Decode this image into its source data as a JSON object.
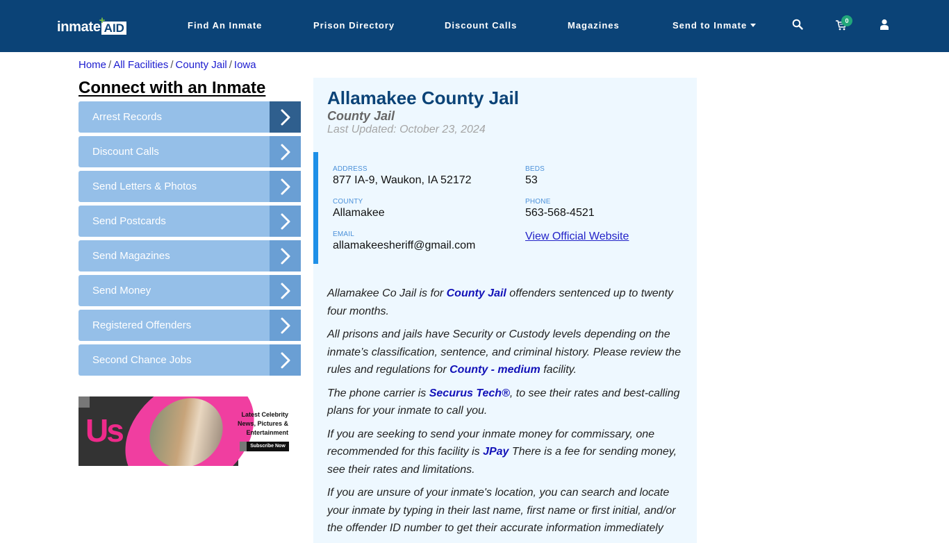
{
  "header": {
    "logo": {
      "part1": "inmate",
      "part2": "AID",
      "plus": "+"
    },
    "nav": [
      {
        "label": "Find An Inmate"
      },
      {
        "label": "Prison Directory"
      },
      {
        "label": "Discount Calls"
      },
      {
        "label": "Magazines"
      },
      {
        "label": "Send to Inmate",
        "has_dropdown": true
      }
    ],
    "icons": {
      "search": "search-icon",
      "cart": "cart-icon",
      "user": "user-icon"
    },
    "cart_count": "0",
    "colors": {
      "bg": "#0b4377",
      "badge": "#21a67a"
    }
  },
  "breadcrumb": [
    {
      "label": "Home"
    },
    {
      "label": "All Facilities"
    },
    {
      "label": "County Jail"
    },
    {
      "label": "Iowa"
    }
  ],
  "breadcrumb_separator": "/",
  "sidebar": {
    "title": "Connect with an Inmate",
    "items": [
      {
        "label": "Arrest Records"
      },
      {
        "label": "Discount Calls"
      },
      {
        "label": "Send Letters & Photos"
      },
      {
        "label": "Send Postcards"
      },
      {
        "label": "Send Magazines"
      },
      {
        "label": "Send Money"
      },
      {
        "label": "Registered Offenders"
      },
      {
        "label": "Second Chance Jobs"
      }
    ],
    "ad": {
      "brand": "Us",
      "line1": "Latest Celebrity",
      "line2": "News, Pictures &",
      "line3": "Entertainment",
      "button": "Subscribe Now"
    }
  },
  "facility": {
    "name": "Allamakee County Jail",
    "type": "County Jail",
    "last_updated": "Last Updated: October 23, 2024",
    "info": {
      "address_label": "ADDRESS",
      "address": "877 IA-9, Waukon, IA 52172",
      "beds_label": "BEDS",
      "beds": "53",
      "county_label": "COUNTY",
      "county": "Allamakee",
      "phone_label": "PHONE",
      "phone": "563-568-4521",
      "email_label": "EMAIL",
      "email": "allamakeesheriff@gmail.com",
      "website_link": "View Official Website"
    },
    "description": [
      {
        "pre": "Allamakee Co Jail is for ",
        "link": "County Jail",
        "post": " offenders sentenced up to twenty four months."
      },
      {
        "pre": "All prisons and jails have Security or Custody levels depending on the inmate’s classification, sentence, and criminal history. Please review the rules and regulations for ",
        "link": "County - medium",
        "post": " facility."
      },
      {
        "pre": "The phone carrier is ",
        "link": "Securus Tech®",
        "post": ", to see their rates and best-calling plans for your inmate to call you."
      },
      {
        "pre": "If you are seeking to send your inmate money for commissary, one recommended for this facility is ",
        "link": "JPay",
        "post": " There is a fee for sending money, see their rates and limitations."
      },
      {
        "pre": "If you are unsure of your inmate's location, you can search and locate your inmate by typing in their last name, first name or first initial, and/or the offender ID number to get their accurate information immediately",
        "link": "",
        "post": ""
      }
    ]
  }
}
